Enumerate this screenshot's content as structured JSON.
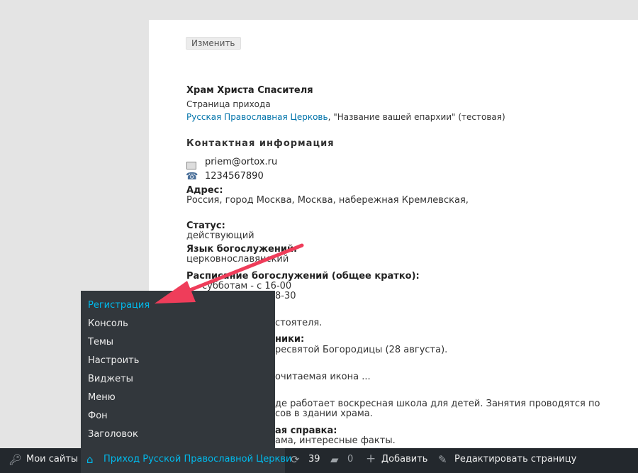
{
  "content": {
    "edit_button": "Изменить",
    "title": "Храм Христа Спасителя",
    "subtitle": "Страница прихода",
    "church_link": "Русская Православная Церковь",
    "church_rest": ", \"Название вашей епархии\" (тестовая)",
    "section_contact": "Контактная информация",
    "email": "priem@ortox.ru",
    "phone": "1234567890",
    "address_label": "Адрес:",
    "address_value": "Россия, город Москва, Москва, набережная Кремлевская,",
    "status_label": "Статус:",
    "status_value": "действующий",
    "language_label": "Язык богослужений:",
    "language_value": "церковнославянский",
    "schedule_label": "Расписание богослужений (общее кратко):",
    "schedule_line1": "субботам - с 16-00",
    "schedule_line2": "8-30",
    "rector_fragment": "стоятеля.",
    "feasts_label_fragment": "ники:",
    "feasts_value_fragment": "ресвятой Богородицы (28 августа).",
    "icon_fragment": "очитаемая икона ...",
    "school_line1": "де работает воскресная школа для детей. Занятия проводятся по",
    "school_line2": "сов в здании храма.",
    "history_label_fragment": "ая справка:",
    "history_value_fragment": "ама, интересные факты."
  },
  "dropdown": {
    "items": [
      "Регистрация",
      "Консоль",
      "Темы",
      "Настроить",
      "Виджеты",
      "Меню",
      "Фон",
      "Заголовок"
    ]
  },
  "adminbar": {
    "my_sites": "Мои сайты",
    "site_name": "Приход Русской Православной Церкви",
    "updates_count": "39",
    "comments_count": "0",
    "add_new": "Добавить",
    "edit_page": "Редактировать страницу"
  },
  "colors": {
    "adminbar_bg": "#23282d",
    "dropdown_bg": "#32373c",
    "link_blue": "#0073aa",
    "highlight_blue": "#00b9eb",
    "arrow_red": "#ef3d5a"
  }
}
